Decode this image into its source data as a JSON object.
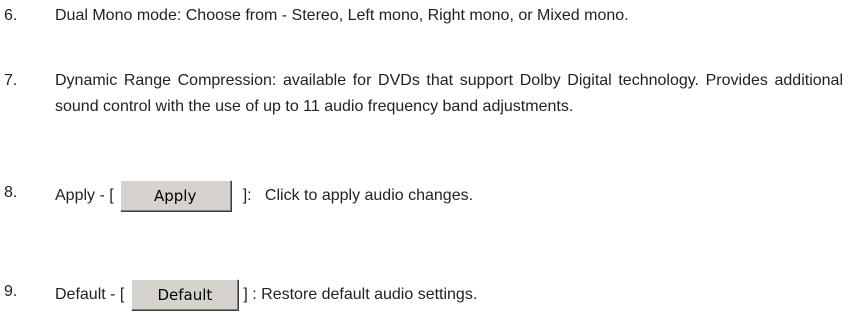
{
  "items": [
    {
      "number": "6.",
      "text": "Dual Mono mode: Choose from - Stereo, Left mono, Right mono, or Mixed mono."
    },
    {
      "number": "7.",
      "text": "Dynamic Range Compression: available for DVDs that support Dolby Digital technology. Provides additional sound control with the use of up to 11 audio frequency band adjustments."
    },
    {
      "number": "8.",
      "prefix": "Apply - [",
      "button_label": "Apply",
      "suffix": "]:   Click to apply audio changes."
    },
    {
      "number": "9.",
      "prefix": "Default - [",
      "button_label": "Default",
      "suffix": "] : Restore default audio settings."
    }
  ]
}
